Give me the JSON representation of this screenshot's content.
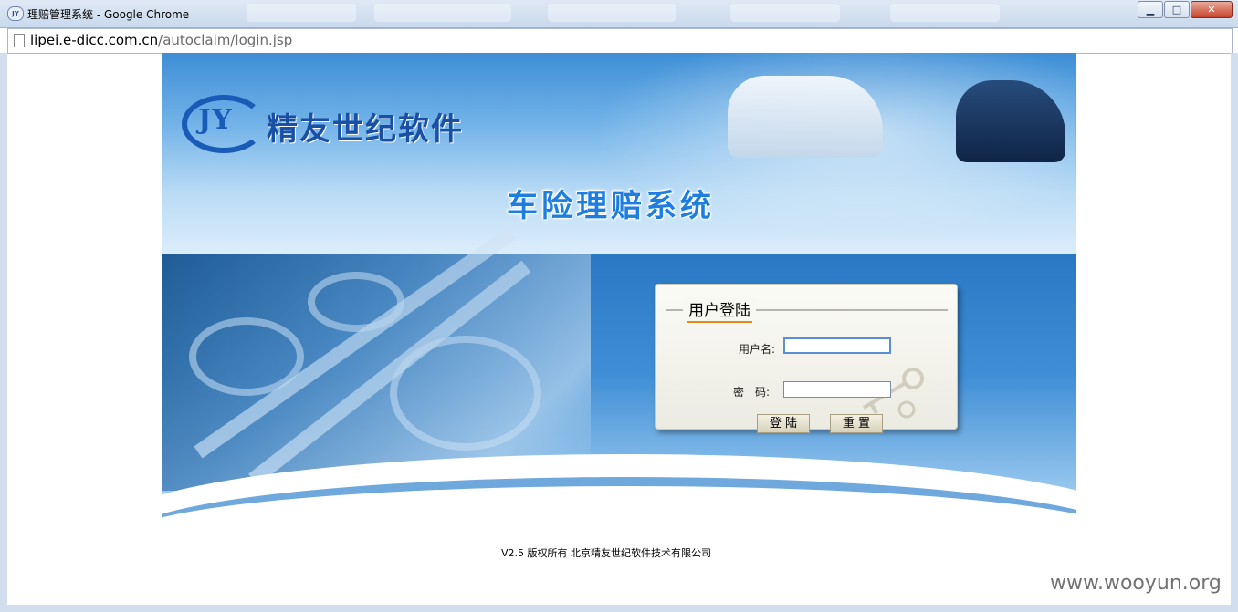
{
  "window": {
    "title": "理赔管理系统 - Google Chrome",
    "icon_text": "JY",
    "min_label": "▁",
    "max_label": "□",
    "close_label": "✕"
  },
  "address": {
    "host": "lipei.e-dicc.com.cn",
    "path": "/autoclaim/login.jsp"
  },
  "banner": {
    "logo_letters": "JY",
    "company": "精友世纪软件",
    "system_title": "车险理赔系统"
  },
  "login": {
    "title": "用户登陆",
    "username_label": "用户名:",
    "username_value": "",
    "password_label": "密　码:",
    "password_value": "",
    "login_button": "登 陆",
    "reset_button": "重 置"
  },
  "footer": {
    "copyright": "V2.5 版权所有 北京精友世纪软件技术有限公司"
  },
  "watermark": "www.wooyun.org",
  "colors": {
    "accent": "#1e7ee0",
    "brand": "#1a4fa6",
    "underline": "#e08a1a"
  }
}
